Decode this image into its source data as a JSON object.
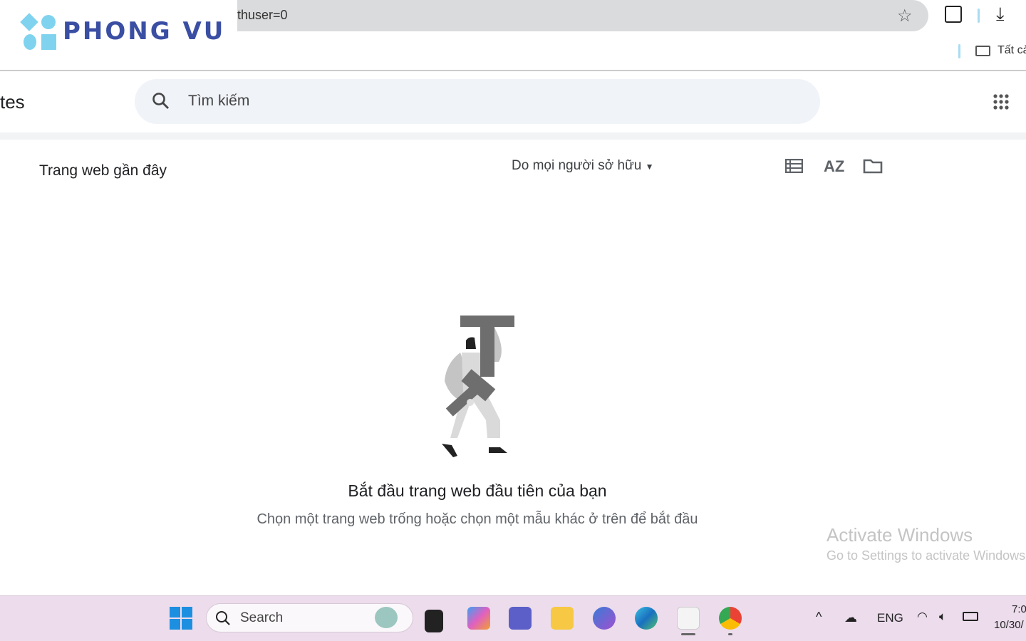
{
  "browser": {
    "url_fragment": "thuser=0",
    "bookmark_folder": "Tất cả"
  },
  "logo": {
    "text": "PHONG VU",
    "color": "#3a4fa3",
    "accent": "#7fd3ee"
  },
  "app": {
    "title_fragment": "tes",
    "search_placeholder": "Tìm kiếm"
  },
  "list": {
    "heading": "Trang web gần đây",
    "owner_filter": "Do mọi người sở hữu"
  },
  "empty_state": {
    "title": "Bắt đầu trang web đầu tiên của bạn",
    "subtitle": "Chọn một trang web trống hoặc chọn một mẫu khác ở trên để bắt đầu"
  },
  "watermark": {
    "line1": "Activate Windows",
    "line2": "Go to Settings to activate Windows."
  },
  "taskbar": {
    "search_label": "Search",
    "language": "ENG",
    "time": "7:0",
    "date": "10/30/"
  }
}
